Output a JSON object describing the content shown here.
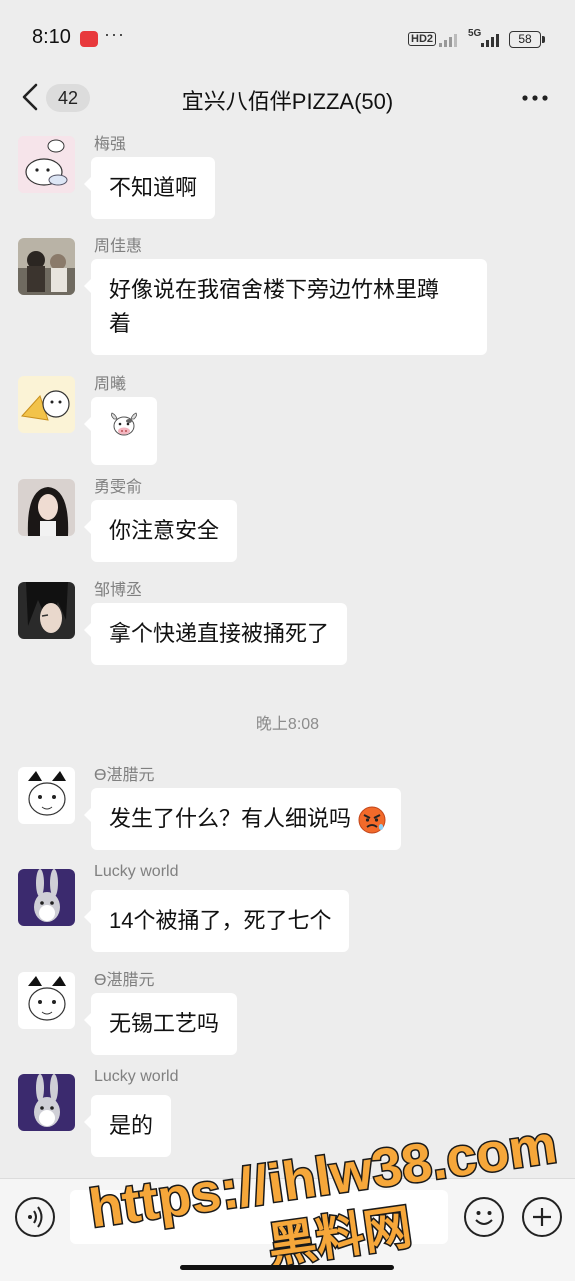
{
  "status_bar": {
    "time": "8:10",
    "dots": "···",
    "network": "HD2",
    "signal": "5G",
    "battery": "58"
  },
  "header": {
    "unread_count": "42",
    "title": "宜兴八佰伴PIZZA(50)"
  },
  "messages": [
    {
      "name": "梅强",
      "text": "不知道啊"
    },
    {
      "name": "周佳惠",
      "text_line1": "好像说在我宿舍楼下旁边竹林里蹲",
      "text_line2": "着"
    },
    {
      "name": "周曦",
      "emoji": "cow-face-emoji"
    },
    {
      "name": "勇雯俞",
      "text": "你注意安全"
    },
    {
      "name": "邹博丞",
      "text": "拿个快递直接被捅死了"
    },
    {
      "name": "ϴ湛腊元",
      "text": "发生了什么？有人细说吗",
      "emoji": "angry-face-emoji"
    },
    {
      "name": "Lucky  world",
      "text": "14个被捅了，死了七个"
    },
    {
      "name": "ϴ湛腊元",
      "text": "无锡工艺吗"
    },
    {
      "name": "Lucky  world",
      "text": "是的"
    }
  ],
  "timestamp": "晚上8:08",
  "watermark": {
    "line1": "https://ihlw38.com",
    "line2": "黑料网"
  },
  "colors": {
    "background": "#ededed",
    "bubble": "#ffffff",
    "watermark_fill": "#f6a73a",
    "watermark_stroke": "#1a1a1a"
  }
}
